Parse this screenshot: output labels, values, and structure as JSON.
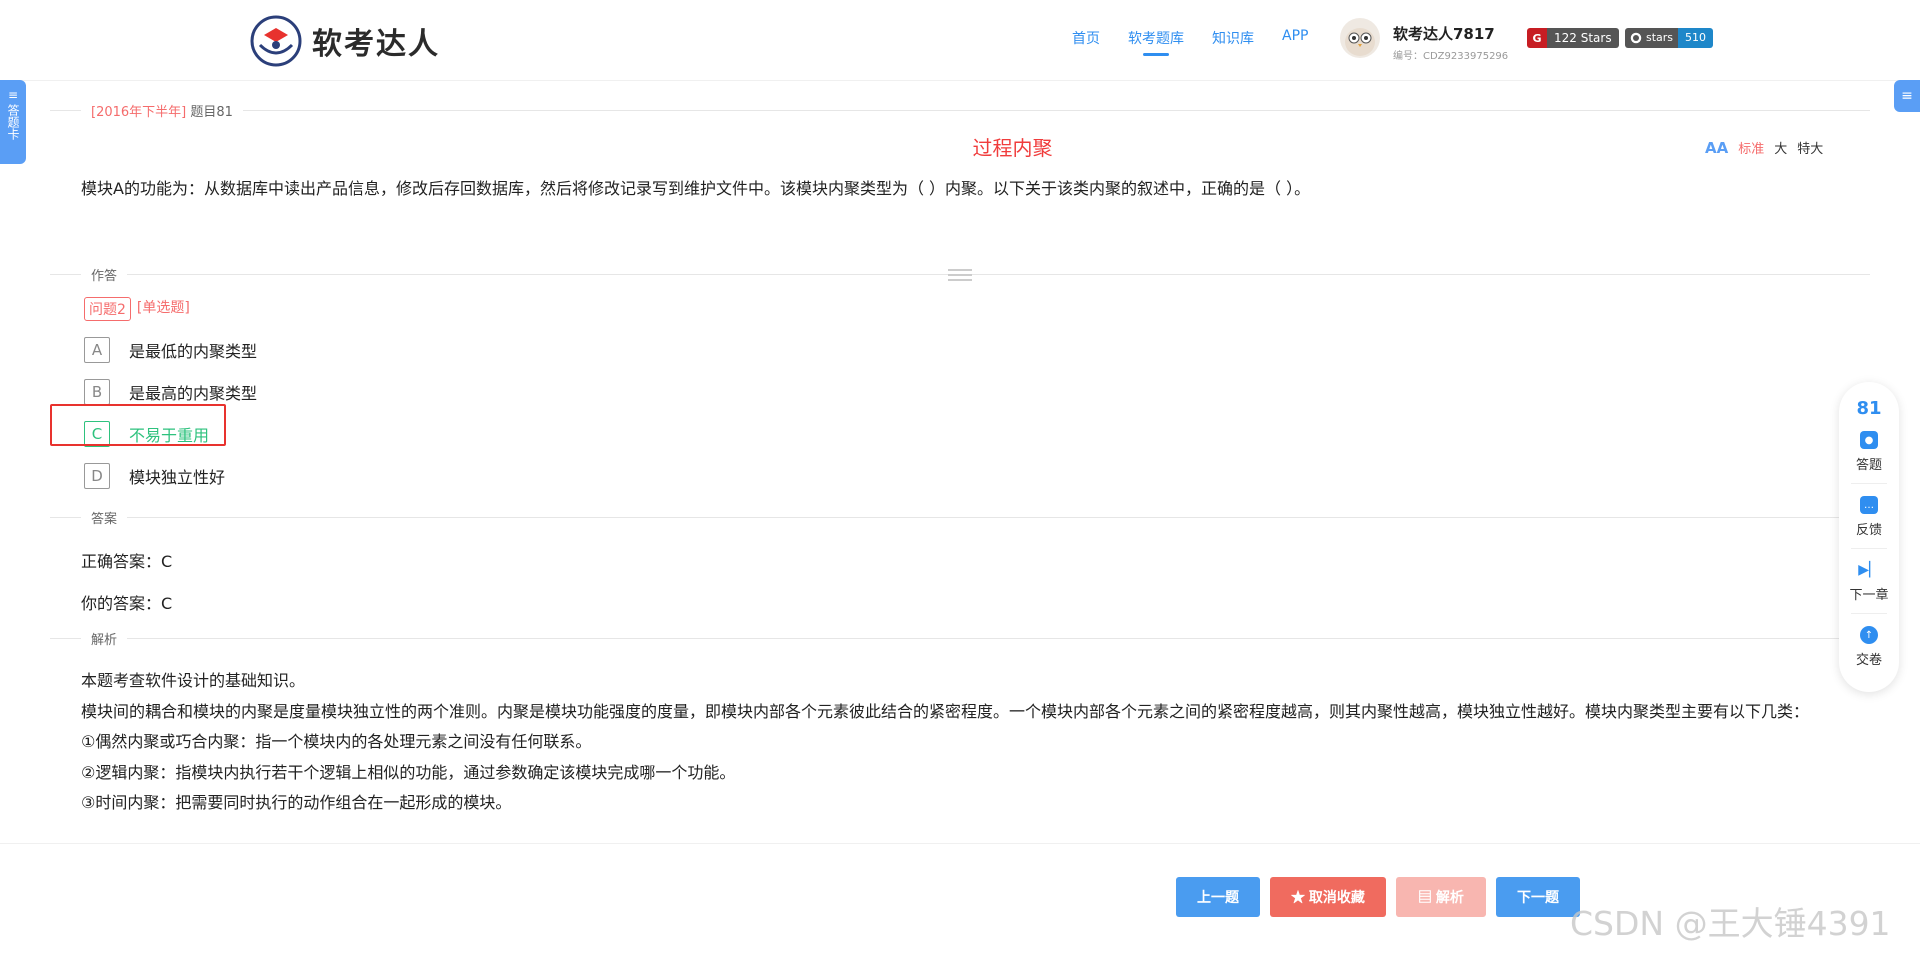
{
  "header": {
    "logo_text": "软考达人",
    "nav": [
      {
        "label": "首页",
        "active": false
      },
      {
        "label": "软考题库",
        "active": true
      },
      {
        "label": "知识库",
        "active": false
      },
      {
        "label": "APP",
        "active": false
      }
    ],
    "user_name": "软考达人7817",
    "user_id": "编号：CDZ9233975296",
    "gitee_badge": "122 Stars",
    "github_label": "stars",
    "github_count": "510"
  },
  "side": {
    "left_tab": "答题卡",
    "left_icon": "≡",
    "right_icon": "≡"
  },
  "question": {
    "year_tag": "[2016年下半年]",
    "number": "题目81",
    "title": "过程内聚",
    "font_sizes": [
      "标准",
      "大",
      "特大"
    ],
    "font_icon": "AA",
    "text": "模块A的功能为：从数据库中读出产品信息，修改后存回数据库，然后将修改记录写到维护文件中。该模块内聚类型为（ ）内聚。以下关于该类内聚的叙述中，正确的是（ ）。"
  },
  "answer_section": {
    "label": "作答",
    "problem_tag": "问题2",
    "type_tag": "[单选题]",
    "options": [
      {
        "letter": "A",
        "text": "是最低的内聚类型"
      },
      {
        "letter": "B",
        "text": "是最高的内聚类型"
      },
      {
        "letter": "C",
        "text": "不易于重用"
      },
      {
        "letter": "D",
        "text": "模块独立性好"
      }
    ]
  },
  "result": {
    "label": "答案",
    "correct": "正确答案：C",
    "yours": "你的答案：C"
  },
  "analysis": {
    "label": "解析",
    "lines": [
      "本题考查软件设计的基础知识。",
      "模块间的耦合和模块的内聚是度量模块独立性的两个准则。内聚是模块功能强度的度量，即模块内部各个元素彼此结合的紧密程度。一个模块内部各个元素之间的紧密程度越高，则其内聚性越高，模块独立性越好。模块内聚类型主要有以下几类：",
      "①偶然内聚或巧合内聚：指一个模块内的各处理元素之间没有任何联系。",
      "②逻辑内聚：指模块内执行若干个逻辑上相似的功能，通过参数确定该模块完成哪一个功能。",
      "③时间内聚：把需要同时执行的动作组合在一起形成的模块。"
    ]
  },
  "float_panel": {
    "number": "81",
    "items": [
      "答题",
      "反馈",
      "下一章",
      "交卷"
    ]
  },
  "bottom": {
    "prev": "上一题",
    "fav": "★ 取消收藏",
    "analysis": "▤ 解析",
    "next": "下一题"
  },
  "watermark": "CSDN @王大锤4391"
}
